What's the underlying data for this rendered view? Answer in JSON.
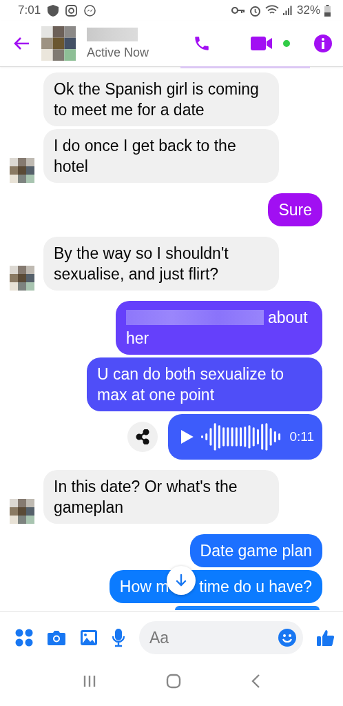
{
  "status_bar": {
    "time": "7:01",
    "battery": "32%"
  },
  "header": {
    "status": "Active Now",
    "online": true
  },
  "messages": [
    {
      "kind": "text",
      "outgoing": false,
      "avatar": false,
      "text": "Ok the Spanish girl is coming to meet me for a date"
    },
    {
      "kind": "text",
      "outgoing": false,
      "avatar": true,
      "text": "I do once I get back to the hotel"
    },
    {
      "kind": "text",
      "outgoing": true,
      "color": "#a10ff2",
      "text": "Sure"
    },
    {
      "kind": "text",
      "outgoing": false,
      "avatar": true,
      "text": "By the way so I shouldn't sexualise, and just flirt?"
    },
    {
      "kind": "redacted",
      "outgoing": true,
      "color": "#6540fb",
      "text": "about her"
    },
    {
      "kind": "text",
      "outgoing": true,
      "color": "#4f4ef8",
      "text": "U can do both sexualize to max at one point"
    },
    {
      "kind": "audio",
      "outgoing": true,
      "color": "#3d5cfb",
      "duration": "0:11"
    },
    {
      "kind": "text",
      "outgoing": false,
      "avatar": true,
      "text": "In this date? Or what's the gameplan"
    },
    {
      "kind": "text",
      "outgoing": true,
      "color": "#1c70ff",
      "text": "Date game plan"
    },
    {
      "kind": "covered",
      "outgoing": true,
      "color": "#0b7bff",
      "text_parts": [
        "How m",
        "time do u have?"
      ]
    }
  ],
  "composer": {
    "placeholder": "Aa"
  }
}
